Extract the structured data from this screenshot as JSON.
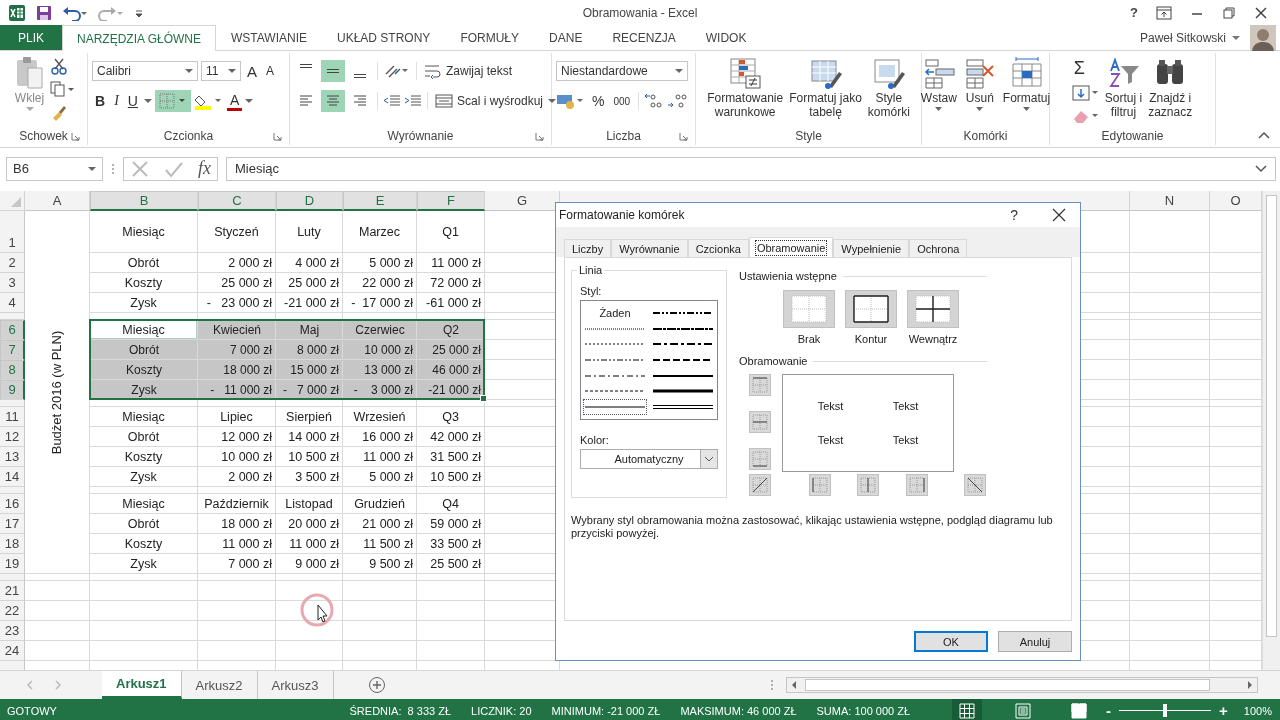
{
  "app": {
    "title": "Obramowania - Excel",
    "help": "?",
    "user": "Paweł Sitkowski"
  },
  "ribbon_tabs": [
    {
      "label": "PLIK",
      "kind": "file",
      "selected": false
    },
    {
      "label": "NARZĘDZIA GŁÓWNE",
      "kind": "tab",
      "selected": true
    },
    {
      "label": "WSTAWIANIE",
      "kind": "tab",
      "selected": false
    },
    {
      "label": "UKŁAD STRONY",
      "kind": "tab",
      "selected": false
    },
    {
      "label": "FORMUŁY",
      "kind": "tab",
      "selected": false
    },
    {
      "label": "DANE",
      "kind": "tab",
      "selected": false
    },
    {
      "label": "RECENZJA",
      "kind": "tab",
      "selected": false
    },
    {
      "label": "WIDOK",
      "kind": "tab",
      "selected": false
    }
  ],
  "ribbon": {
    "clipboard": {
      "paste": "Wklej",
      "label": "Schowek"
    },
    "font": {
      "name": "Calibri",
      "size": "11",
      "grow": "A",
      "shrink": "A",
      "bold": "B",
      "italic": "I",
      "underline": "U",
      "color_letter": "A",
      "borders_selected": true,
      "label": "Czcionka"
    },
    "alignment": {
      "vertical": [
        {
          "selected": false
        },
        {
          "selected": true
        },
        {
          "selected": false
        }
      ],
      "horizontal": [
        {
          "selected": false
        },
        {
          "selected": true
        },
        {
          "selected": false
        }
      ],
      "wrap": "Zawijaj tekst",
      "merge": "Scal i wyśrodkuj",
      "label": "Wyrównanie"
    },
    "number": {
      "format": "Niestandardowe",
      "percent": "%",
      "thousands": "000",
      "label": "Liczba"
    },
    "styles": {
      "buttons": [
        {
          "label": "Formatowanie\nwarunkowe",
          "kind": "conditional"
        },
        {
          "label": "Formatuj jako\ntabelę",
          "kind": "table"
        },
        {
          "label": "Style\nkomórki",
          "kind": "cellstyle"
        }
      ],
      "label": "Style"
    },
    "cells": {
      "buttons": [
        {
          "label": "Wstaw",
          "kind": "insert"
        },
        {
          "label": "Usuń",
          "kind": "delete"
        },
        {
          "label": "Formatuj",
          "kind": "format"
        }
      ],
      "label": "Komórki"
    },
    "editing": {
      "autosum": "Σ",
      "buttons": [
        {
          "label": "Sortuj i\nfiltruj",
          "kind": "sort"
        },
        {
          "label": "Znajdź i\nzaznacz",
          "kind": "find"
        }
      ],
      "label": "Edytowanie"
    }
  },
  "formula_bar": {
    "name_box": "B6",
    "fx": "fx",
    "value": "Miesiąc"
  },
  "sheet": {
    "merged_label": "Budżet 2016 (w PLN)",
    "columns": [
      {
        "letter": "A",
        "selected": false
      },
      {
        "letter": "B",
        "selected": true
      },
      {
        "letter": "C",
        "selected": true
      },
      {
        "letter": "D",
        "selected": true
      },
      {
        "letter": "E",
        "selected": true
      },
      {
        "letter": "F",
        "selected": true
      },
      {
        "letter": "G",
        "selected": false
      },
      {
        "letter": "N",
        "selected": false
      },
      {
        "letter": "O",
        "selected": false
      }
    ],
    "rows": [
      {
        "num": "1",
        "kind": "title",
        "selected": false,
        "active": false,
        "cells": [
          "Miesiąc",
          "Styczeń",
          "Luty",
          "Marzec",
          "Q1"
        ]
      },
      {
        "num": "2",
        "kind": "data",
        "selected": false,
        "active": false,
        "cells": [
          "Obrót",
          "2 000 zł",
          "4 000 zł",
          "5 000 zł",
          "11 000 zł"
        ]
      },
      {
        "num": "3",
        "kind": "data",
        "selected": false,
        "active": false,
        "cells": [
          "Koszty",
          "25 000 zł",
          "25 000 zł",
          "22 000 zł",
          "72 000 zł"
        ]
      },
      {
        "num": "4",
        "kind": "data",
        "selected": false,
        "active": false,
        "cells": [
          "Zysk",
          "-   23 000 zł",
          "-21 000 zł",
          "-  17 000 zł",
          "-61 000 zł"
        ]
      },
      {
        "kind": "thin",
        "selected": false
      },
      {
        "num": "6",
        "kind": "header",
        "selected": true,
        "active": true,
        "cells": [
          "Miesiąc",
          "Kwiecień",
          "Maj",
          "Czerwiec",
          "Q2"
        ]
      },
      {
        "num": "7",
        "kind": "data",
        "selected": true,
        "active": false,
        "cells": [
          "Obrót",
          "7 000 zł",
          "8 000 zł",
          "10 000 zł",
          "25 000 zł"
        ]
      },
      {
        "num": "8",
        "kind": "data",
        "selected": true,
        "active": false,
        "cells": [
          "Koszty",
          "18 000 zł",
          "15 000 zł",
          "13 000 zł",
          "46 000 zł"
        ]
      },
      {
        "num": "9",
        "kind": "data",
        "selected": true,
        "active": false,
        "cells": [
          "Zysk",
          "-   11 000 zł",
          "-   7 000 zł",
          "-    3 000 zł",
          "-21 000 zł"
        ]
      },
      {
        "kind": "thin",
        "selected": false
      },
      {
        "num": "11",
        "kind": "header",
        "selected": false,
        "active": false,
        "cells": [
          "Miesiąc",
          "Lipiec",
          "Sierpień",
          "Wrzesień",
          "Q3"
        ]
      },
      {
        "num": "12",
        "kind": "data",
        "selected": false,
        "active": false,
        "cells": [
          "Obrót",
          "12 000 zł",
          "14 000 zł",
          "16 000 zł",
          "42 000 zł"
        ]
      },
      {
        "num": "13",
        "kind": "data",
        "selected": false,
        "active": false,
        "cells": [
          "Koszty",
          "10 000 zł",
          "10 500 zł",
          "11 000 zł",
          "31 500 zł"
        ]
      },
      {
        "num": "14",
        "kind": "data",
        "selected": false,
        "active": false,
        "cells": [
          "Zysk",
          "2 000 zł",
          "3 500 zł",
          "5 000 zł",
          "10 500 zł"
        ]
      },
      {
        "kind": "thin",
        "selected": false
      },
      {
        "num": "16",
        "kind": "header",
        "selected": false,
        "active": false,
        "cells": [
          "Miesiąc",
          "Październik",
          "Listopad",
          "Grudzień",
          "Q4"
        ]
      },
      {
        "num": "17",
        "kind": "data",
        "selected": false,
        "active": false,
        "cells": [
          "Obrót",
          "18 000 zł",
          "20 000 zł",
          "21 000 zł",
          "59 000 zł"
        ]
      },
      {
        "num": "18",
        "kind": "data",
        "selected": false,
        "active": false,
        "cells": [
          "Koszty",
          "11 000 zł",
          "11 000 zł",
          "11 500 zł",
          "33 500 zł"
        ]
      },
      {
        "num": "19",
        "kind": "data",
        "selected": false,
        "active": false,
        "cells": [
          "Zysk",
          "7 000 zł",
          "9 000 zł",
          "9 500 zł",
          "25 500 zł"
        ]
      },
      {
        "kind": "thin",
        "selected": false
      },
      {
        "num": "21",
        "kind": "empty",
        "selected": false,
        "active": false
      },
      {
        "num": "22",
        "kind": "empty",
        "selected": false,
        "active": false
      },
      {
        "num": "23",
        "kind": "empty",
        "selected": false,
        "active": false
      },
      {
        "num": "24",
        "kind": "empty",
        "selected": false,
        "active": false
      }
    ]
  },
  "dialog": {
    "title": "Formatowanie komórek",
    "help": "?",
    "tabs": [
      {
        "label": "Liczby",
        "selected": false
      },
      {
        "label": "Wyrównanie",
        "selected": false
      },
      {
        "label": "Czcionka",
        "selected": false
      },
      {
        "label": "Obramowanie",
        "selected": true
      },
      {
        "label": "Wypełnienie",
        "selected": false
      },
      {
        "label": "Ochrona",
        "selected": false
      }
    ],
    "line": {
      "label": "Linia",
      "style_label": "Styl:",
      "styles": [
        {
          "kind": "none",
          "label": "Żaden",
          "selected": false
        },
        {
          "kind": "hair",
          "selected": false
        },
        {
          "kind": "dotted",
          "selected": false
        },
        {
          "kind": "dashdotdot",
          "selected": false
        },
        {
          "kind": "dashdot",
          "selected": false
        },
        {
          "kind": "dashed",
          "selected": false
        },
        {
          "kind": "thin",
          "selected": true
        },
        {
          "kind": "mdashdotdot",
          "selected": false
        },
        {
          "kind": "slanted",
          "selected": false
        },
        {
          "kind": "mdashdot",
          "selected": false
        },
        {
          "kind": "mdashed",
          "selected": false
        },
        {
          "kind": "medium",
          "selected": false
        },
        {
          "kind": "thick",
          "selected": false
        },
        {
          "kind": "double",
          "selected": false
        }
      ],
      "color_label": "Kolor:",
      "color_value": "Automatyczny"
    },
    "presets": {
      "label": "Ustawienia wstępne",
      "buttons": [
        {
          "label": "Brak",
          "kind": "none"
        },
        {
          "label": "Kontur",
          "kind": "outline"
        },
        {
          "label": "Wewnątrz",
          "kind": "inside"
        }
      ]
    },
    "border": {
      "label": "Obramowanie",
      "side_buttons": [
        {
          "kind": "top"
        },
        {
          "kind": "middle"
        },
        {
          "kind": "bottom"
        }
      ],
      "bottom_buttons": [
        {
          "kind": "diagup"
        },
        {
          "kind": "left"
        },
        {
          "kind": "center"
        },
        {
          "kind": "right"
        },
        {
          "kind": "diagdown"
        }
      ],
      "preview_texts": [
        "Tekst",
        "Tekst",
        "Tekst",
        "Tekst"
      ]
    },
    "description": "Wybrany styl obramowania można zastosować, klikając ustawienia wstępne, podgląd diagramu lub przyciski powyżej.",
    "buttons": [
      {
        "label": "OK",
        "kind": "default"
      },
      {
        "label": "Anuluj",
        "kind": "normal"
      }
    ]
  },
  "sheet_tabs": [
    {
      "label": "Arkusz1",
      "selected": true
    },
    {
      "label": "Arkusz2",
      "selected": false
    },
    {
      "label": "Arkusz3",
      "selected": false
    }
  ],
  "status_bar": {
    "mode": "GOTOWY",
    "stats": [
      "ŚREDNIA:  8 333 ZŁ",
      "LICZNIK: 20",
      "MINIMUM: -21 000 ZŁ",
      "MAKSIMUM: 46 000 ZŁ",
      "SUMA: 100 000 ZŁ"
    ],
    "views": [
      {
        "kind": "normal",
        "selected": true
      },
      {
        "kind": "layout",
        "selected": false
      },
      {
        "kind": "pagebreak",
        "selected": false
      }
    ],
    "zoom_out": "-",
    "zoom_in": "+",
    "zoom": {
      "level": 0.5
    },
    "zoom_label": "100%"
  }
}
